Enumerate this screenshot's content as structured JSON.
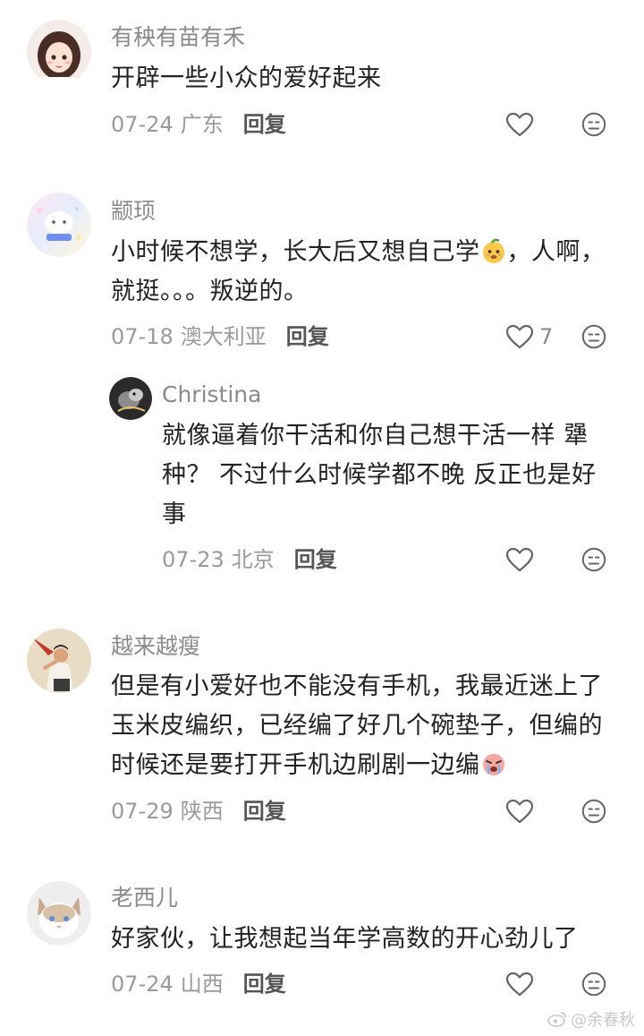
{
  "comments": [
    {
      "username": "有秧有苗有禾",
      "text": "开辟一些小众的爱好起来",
      "date": "07-24",
      "location": "广东",
      "reply_label": "回复",
      "like_count": ""
    },
    {
      "username": "颛顼",
      "text_part1": "小时候不想学，长大后又想自己学",
      "text_part2": "，人啊，就挺。。。叛逆的。",
      "date": "07-18",
      "location": "澳大利亚",
      "reply_label": "回复",
      "like_count": "7"
    },
    {
      "username": "Christina",
      "text": "就像逼着你干活和你自己想干活一样 犟种？ 不过什么时候学都不晚 反正也是好事",
      "date": "07-23",
      "location": "北京",
      "reply_label": "回复",
      "like_count": ""
    },
    {
      "username": "越来越瘦",
      "text_part1": "但是有小爱好也不能没有手机，我最近迷上了玉米皮编织，已经编了好几个碗垫子，但编的时候还是要打开手机边刷剧一边编",
      "date": "07-29",
      "location": "陕西",
      "reply_label": "回复",
      "like_count": ""
    },
    {
      "username": "老西儿",
      "text": "好家伙，让我想起当年学高数的开心劲儿了",
      "date": "07-24",
      "location": "山西",
      "reply_label": "回复",
      "like_count": ""
    }
  ],
  "watermark": "@余春秋",
  "icons": {
    "like": "heart-outline-icon",
    "dislike": "meh-face-icon"
  },
  "colors": {
    "username": "#8a8a8a",
    "text": "#222222",
    "meta": "#9a9a9a",
    "reply": "#555555",
    "icon": "#666666"
  }
}
